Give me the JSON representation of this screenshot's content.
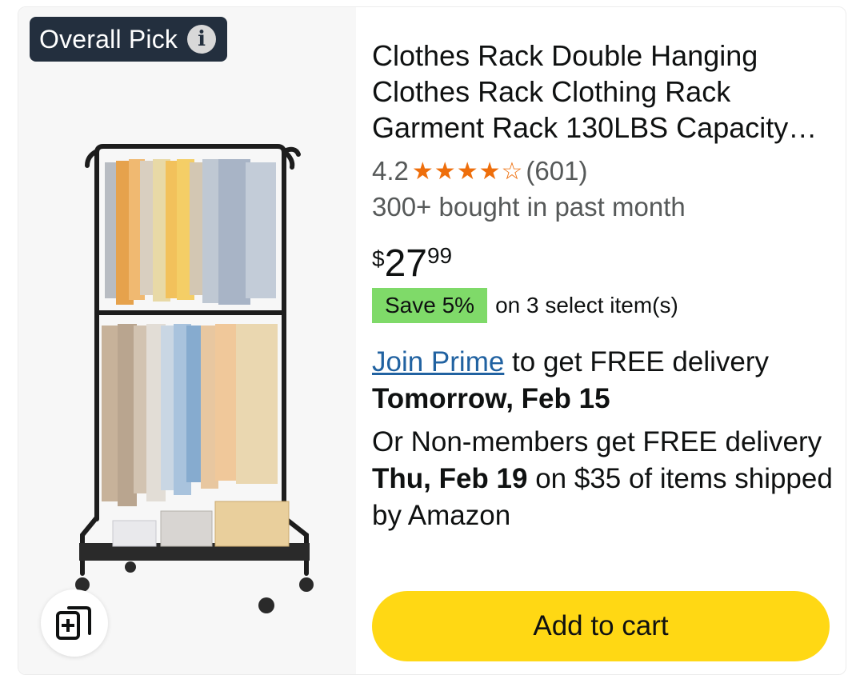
{
  "badge": {
    "label": "Overall Pick",
    "info_icon": "info-icon"
  },
  "product": {
    "title": "Clothes Rack Double Hanging Clothes Rack Clothing Rack Garment Rack 130LBS Capacity…",
    "rating_value": "4.2",
    "rating_stars": 4.2,
    "rating_count": "(601)",
    "bought": "300+ bought in past month",
    "price_symbol": "$",
    "price_whole": "27",
    "price_fraction": "99"
  },
  "promo": {
    "badge": "Save 5%",
    "text": "on 3 select item(s)",
    "badge_color": "#7fda69"
  },
  "delivery": {
    "prime_link": "Join Prime",
    "prime_text": " to get FREE delivery",
    "prime_date": "Tomorrow, Feb 15",
    "nonmember_prefix": "Or Non-members get FREE delivery ",
    "nonmember_date": "Thu, Feb 19",
    "nonmember_suffix": " on $35 of items shipped by Amazon"
  },
  "actions": {
    "add_to_cart": "Add to cart",
    "add_to_cart_color": "#ffd814",
    "compare_icon": "compare-add-icon"
  }
}
